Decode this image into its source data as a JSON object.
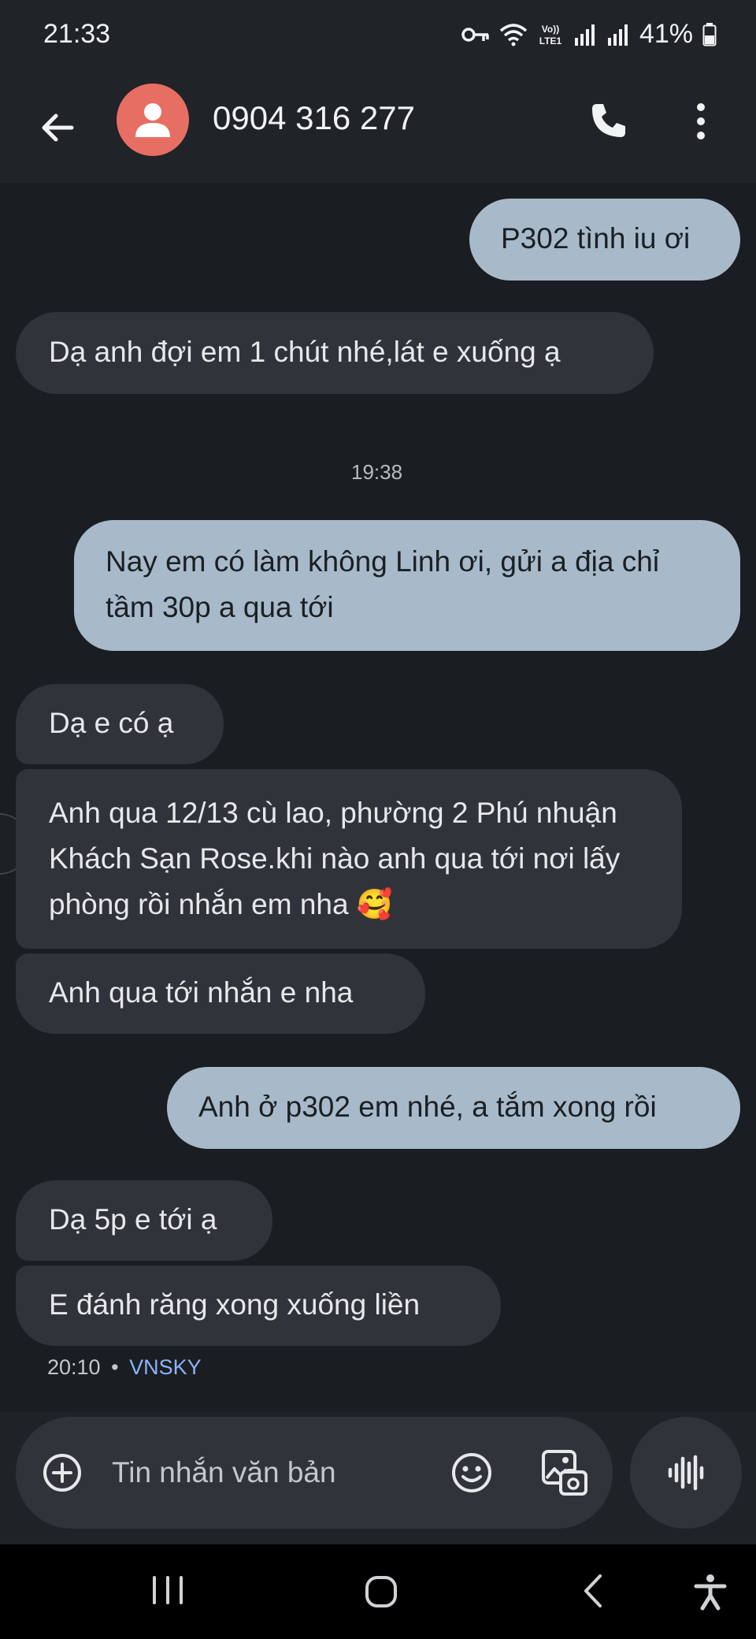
{
  "status_bar": {
    "time": "21:33",
    "battery": "41%",
    "network_label": "VoLTE1"
  },
  "header": {
    "contact": "0904 316 277"
  },
  "messages": [
    {
      "dir": "out",
      "text": "P302 tình iu ơi"
    },
    {
      "dir": "in",
      "text": "Dạ anh đợi em 1 chút nhé,lát e xuống ạ"
    },
    {
      "timestamp": "19:38"
    },
    {
      "dir": "out",
      "text": "Nay em có làm không Linh ơi, gửi a địa chỉ tầm 30p a qua tới"
    },
    {
      "dir": "in",
      "text": "Dạ e có ạ"
    },
    {
      "dir": "in",
      "text": "Anh qua 12/13 cù lao, phường 2 Phú nhuận Khách Sạn Rose.khi nào anh qua tới nơi lấy phòng rồi nhắn em nha 🥰"
    },
    {
      "dir": "in",
      "text": "Anh qua tới nhắn e nha"
    },
    {
      "dir": "out",
      "text": "Anh ở p302 em nhé, a tắm xong rồi"
    },
    {
      "dir": "in",
      "text": "Dạ 5p e tới ạ"
    },
    {
      "dir": "in",
      "text": "E đánh răng xong xuống liền"
    }
  ],
  "last_message_meta": {
    "time": "20:10",
    "separator": "•",
    "carrier": "VNSKY"
  },
  "composer": {
    "placeholder": "Tin nhắn văn bản"
  },
  "colors": {
    "outgoing_bubble": "#a8bac9",
    "incoming_bubble": "#30343a",
    "avatar": "#e76e63",
    "carrier_link": "#8ab4f8"
  },
  "icons": [
    "back-arrow-icon",
    "person-icon",
    "phone-icon",
    "more-vert-icon",
    "add-circle-icon",
    "emoji-icon",
    "gallery-icon",
    "voice-waveform-icon"
  ]
}
